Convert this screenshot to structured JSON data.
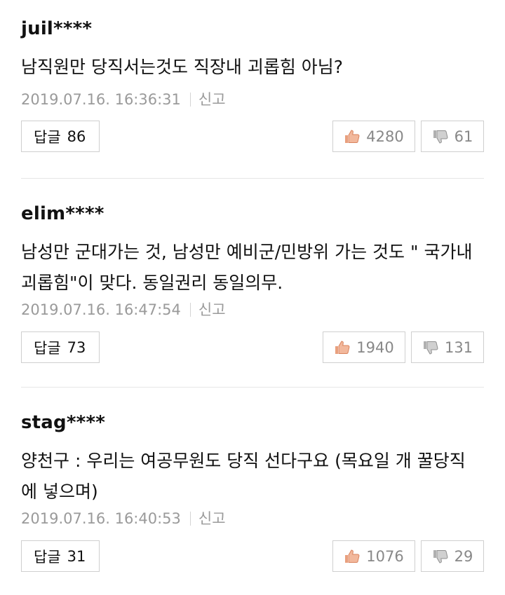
{
  "comments": [
    {
      "author": "juil****",
      "content": "남직원만 당직서는것도 직장내 괴롭힘 아님?",
      "timestamp": "2019.07.16. 16:36:31",
      "report_label": "신고",
      "reply_label": "답글",
      "reply_count": "86",
      "like_count": "4280",
      "dislike_count": "61"
    },
    {
      "author": "elim****",
      "content": "남성만 군대가는 것, 남성만 예비군/민방위 가는 것도 \" 국가내 괴롭힘\"이 맞다. 동일권리 동일의무.",
      "timestamp": "2019.07.16. 16:47:54",
      "report_label": "신고",
      "reply_label": "답글",
      "reply_count": "73",
      "like_count": "1940",
      "dislike_count": "131"
    },
    {
      "author": "stag****",
      "content": "양천구 : 우리는 여공무원도 당직 선다구요 (목요일 개 꿀당직에 넣으며)",
      "timestamp": "2019.07.16. 16:40:53",
      "report_label": "신고",
      "reply_label": "답글",
      "reply_count": "31",
      "like_count": "1076",
      "dislike_count": "29"
    }
  ],
  "icons": {
    "like": "thumbs-up-icon",
    "dislike": "thumbs-down-icon"
  },
  "colors": {
    "like_icon": "#e9a07e",
    "dislike_icon": "#9a9a9a",
    "meta_text": "#9a9a9a",
    "divider": "#e6e6e6"
  }
}
